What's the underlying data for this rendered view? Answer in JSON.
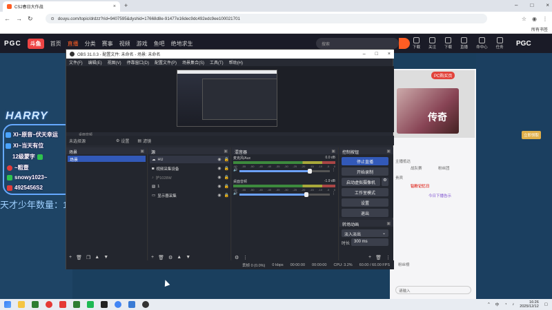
{
  "browser": {
    "tab_title": "CS2春日大作战",
    "url": "douyu.com/topic/drdzz?rid=9407595&dyshid=17668d8e-91477e16dec9dc492edc9ee100021701",
    "bookmarks_label": "所有书签"
  },
  "douyu": {
    "pgc_left": "PGC",
    "logo": "斗鱼",
    "nav": [
      "首页",
      "直播",
      "分类",
      "赛事",
      "视频",
      "游戏",
      "鱼吧",
      "绝地求生"
    ],
    "active_nav": "直播",
    "search_placeholder": "搜索",
    "nav_icons": [
      "下载",
      "关注",
      "下载",
      "直播",
      "命中心",
      "任务"
    ],
    "pgc_right": "PGC"
  },
  "overlay": {
    "title": "HARRY",
    "lines": [
      "XI~原音~伏天幸运",
      "XI~当天有位",
      "12级蒙字",
      "~粗壹",
      "snowy1023~",
      "4925456S2"
    ],
    "count_text": "天才少年数量：13"
  },
  "side": {
    "ad_badge": "PC购买页",
    "hero_text": "传奇",
    "hero_button": "立即领取",
    "chat": [
      "主播抵达",
      "战队赛",
      "粉丝团",
      "贵宾",
      "钻粉记忆日",
      "今日下播告示",
      "粉丝榜",
      "请输入"
    ]
  },
  "obs": {
    "title": "OBS 31.0.3 - 配置文件: 未命名 - 场景: 未命名",
    "menu": [
      "文件(F)",
      "编辑(E)",
      "视图(V)",
      "停靠窗口(D)",
      "配置文件(P)",
      "场景集合(S)",
      "工具(T)",
      "帮助(H)"
    ],
    "scene_dropdown": "桌面音频",
    "prop_label": "未选择源",
    "prop_settings": "设置",
    "prop_filters": "滤镜",
    "docks": {
      "scenes": "场景",
      "sources": "源",
      "mixer": "混音器",
      "controls": "控制按钮",
      "transitions": "转场动画"
    },
    "scenes": [
      "场景"
    ],
    "sources": [
      {
        "icon": "cloud",
        "name": "HU"
      },
      {
        "icon": "camera",
        "name": "视频采集设备"
      },
      {
        "icon": "volume",
        "name": "护1028W"
      },
      {
        "icon": "image",
        "name": "1"
      },
      {
        "icon": "monitor",
        "name": "显示器采集"
      }
    ],
    "mixer": [
      {
        "name": "麦克风/Aux",
        "db": "0.0 dB",
        "level": 0.78
      },
      {
        "name": "桌面音频",
        "db": "-1.9 dB",
        "level": 0.74
      }
    ],
    "mixer_ticks": [
      "-60",
      "-55",
      "-50",
      "-45",
      "-40",
      "-35",
      "-30",
      "-25",
      "-20",
      "-15",
      "-10",
      "-5",
      "0"
    ],
    "controls": [
      "停止直播",
      "开始录制",
      "启动虚拟摄像机",
      "工作室模式",
      "设置",
      "退出"
    ],
    "transition_type": "淡入淡出",
    "duration_label": "时长",
    "duration_value": "300 ms",
    "status": {
      "dropped": "丢帧 0 (0.0%)",
      "bitrate": "0 kbps",
      "time1": "00:00:00",
      "time2": "00:00:00",
      "cpu": "CPU: 3.2%",
      "fps": "60.00 / 60.00 FPS"
    }
  },
  "taskbar": {
    "time": "16:26",
    "date": "2025/12/12",
    "lang": "中"
  }
}
